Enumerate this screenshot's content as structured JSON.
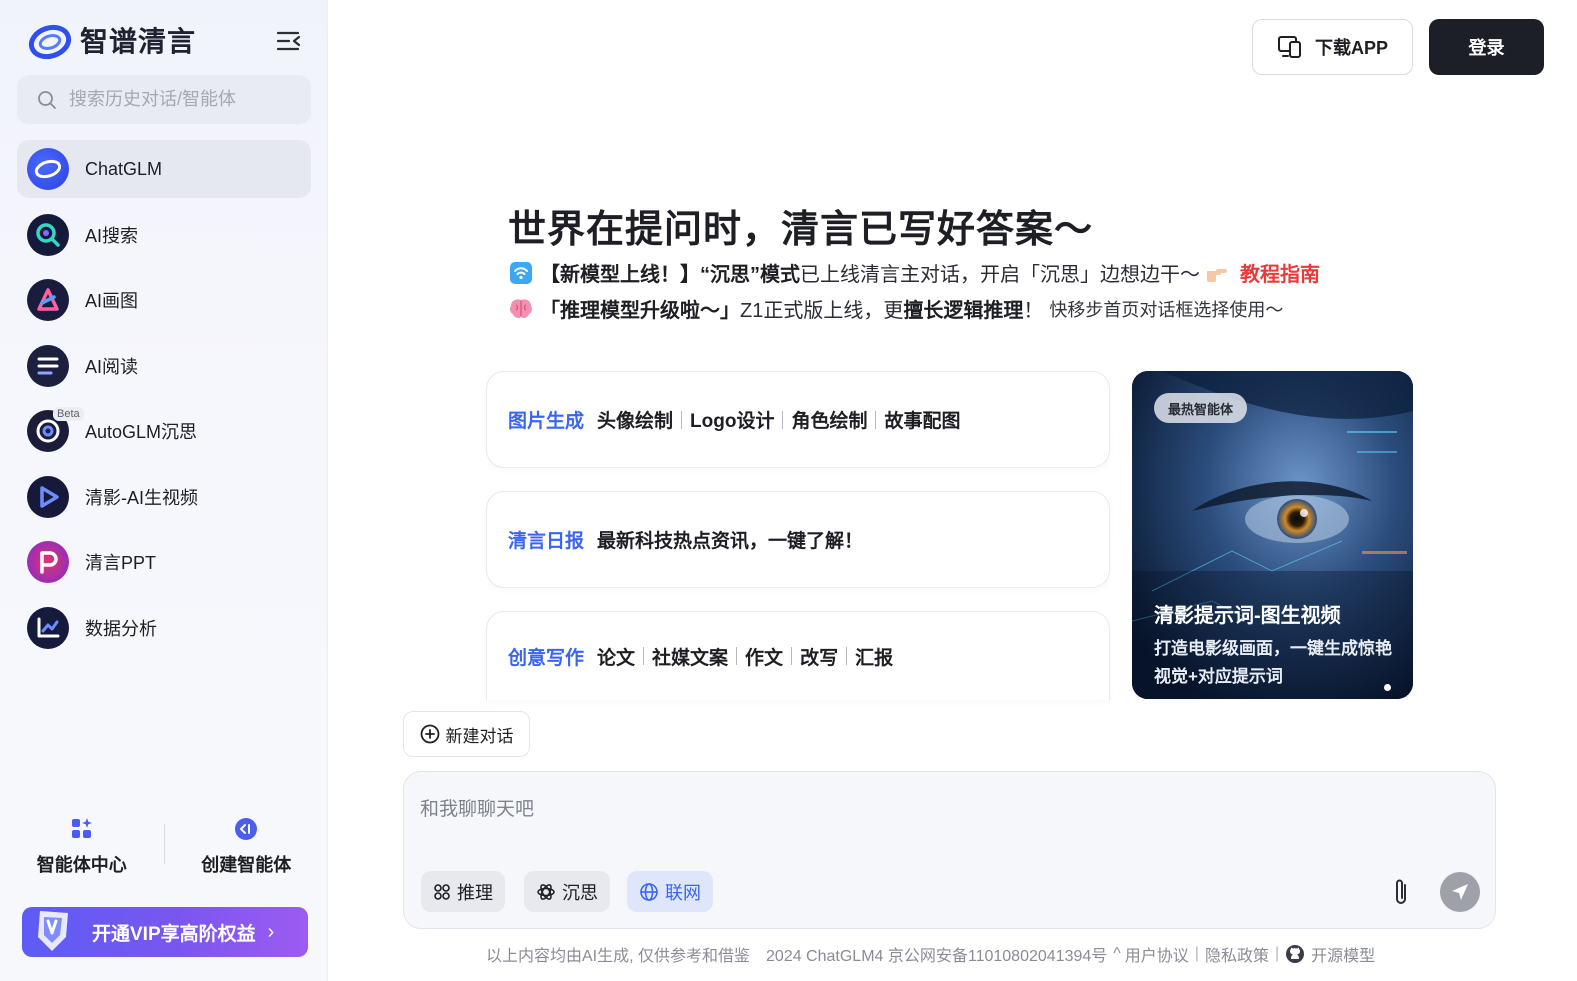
{
  "sidebar": {
    "brand_name": "智谱清言",
    "search_placeholder": "搜索历史对话/智能体",
    "items": [
      {
        "label": "ChatGLM"
      },
      {
        "label": "AI搜索"
      },
      {
        "label": "AI画图"
      },
      {
        "label": "AI阅读"
      },
      {
        "label": "AutoGLM沉思",
        "badge": "Beta"
      },
      {
        "label": "清影-AI生视频"
      },
      {
        "label": "清言PPT"
      },
      {
        "label": "数据分析"
      }
    ],
    "agent_center": "智能体中心",
    "create_agent": "创建智能体",
    "vip_label": "开通VIP享高阶权益",
    "vip_chevron": "›"
  },
  "header": {
    "download_label": "下载APP",
    "login_label": "登录"
  },
  "hero": {
    "title": "世界在提问时，清言已写好答案～",
    "notice1": {
      "bold": "【新模型上线！】“沉思”模式",
      "text": "已上线清言主对话，开启「沉思」边想边干～",
      "link": "教程指南"
    },
    "notice2": {
      "bold1": "「推理模型升级啦～」",
      "text": "Z1正式版上线，更",
      "bold2": "擅长逻辑推理",
      "text2": "！",
      "small": "快移步首页对话框选择使用～"
    }
  },
  "cards": [
    {
      "category": "图片生成",
      "items": [
        "头像绘制",
        "Logo设计",
        "角色绘制",
        "故事配图"
      ]
    },
    {
      "category": "清言日报",
      "items": [
        "最新科技热点资讯，一键了解！"
      ]
    },
    {
      "category": "创意写作",
      "items": [
        "论文",
        "社媒文案",
        "作文",
        "改写",
        "汇报"
      ]
    }
  ],
  "promo": {
    "badge": "最热智能体",
    "title": "清影提示词-图生视频",
    "desc": "打造电影级画面，一键生成惊艳视觉+对应提示词"
  },
  "chat": {
    "new_chat": "新建对话",
    "placeholder": "和我聊聊天吧",
    "modes": [
      {
        "label": "推理",
        "active": false
      },
      {
        "label": "沉思",
        "active": false
      },
      {
        "label": "联网",
        "active": true
      }
    ]
  },
  "footer": {
    "disclaimer": "以上内容均由AI生成, 仅供参考和借鉴",
    "copyright": "2024 ChatGLM4 京公网安备11010802041394号",
    "caret": "^",
    "user_agreement": "用户协议",
    "privacy": "隐私政策",
    "open_source": "开源模型"
  },
  "colors": {
    "accent": "#3a64f2",
    "link_red": "#e73a3a",
    "login_bg": "#1c1f26",
    "vip_start": "#5c5cf5",
    "vip_end": "#9d5bf1"
  }
}
